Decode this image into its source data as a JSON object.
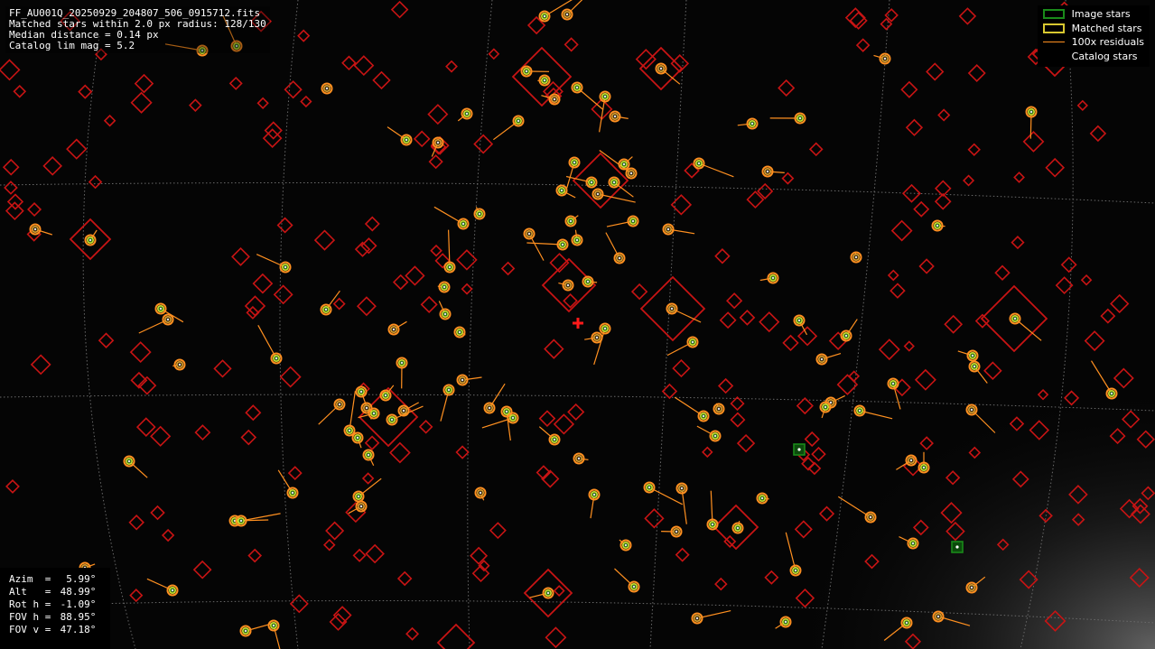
{
  "info": {
    "filename": "FF_AU001Q_20250929_204807_506_0915712.fits",
    "matched": "Matched stars within 2.0 px radius: 128/130",
    "median": "Median distance = 0.14 px",
    "limmag": "Catalog lim mag = 5.2"
  },
  "legend": {
    "image_stars": "Image stars",
    "matched_stars": "Matched stars",
    "residuals": "100x residuals",
    "catalog_stars": "Catalog stars"
  },
  "pointing": {
    "azim_label": "Azim  =",
    "azim_value": "  5.99°",
    "alt_label": "Alt   =",
    "alt_value": " 48.99°",
    "rot_label": "Rot h =",
    "rot_value": " -1.09°",
    "fovh_label": "FOV h =",
    "fovh_value": " 88.95°",
    "fovv_label": "FOV v =",
    "fovv_value": " 47.18°"
  },
  "colors": {
    "background": "#050505",
    "catalog": "#c81414",
    "matched": "#d8c830",
    "image": "#1a8a1a",
    "residual": "#ff9020",
    "center_marker": "#ff1a1a",
    "grid": "#6a6a6a"
  }
}
